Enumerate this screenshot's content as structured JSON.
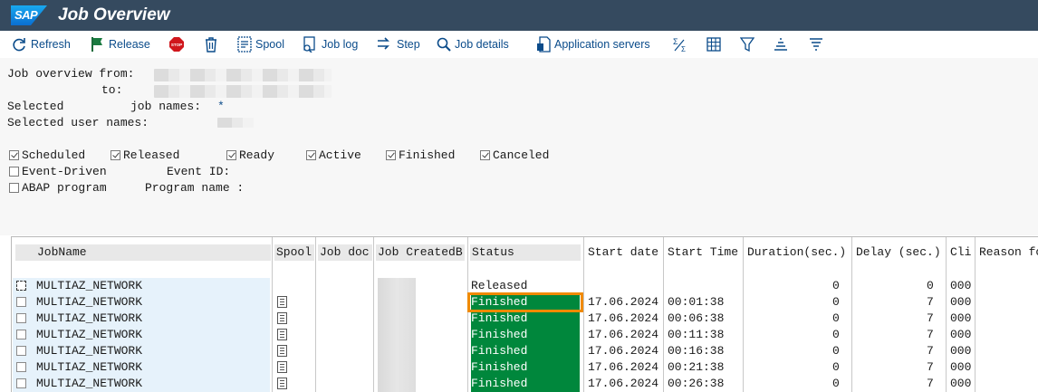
{
  "app": {
    "logo": "SAP",
    "title": "Job Overview"
  },
  "toolbar": {
    "refresh": "Refresh",
    "release": "Release",
    "spool": "Spool",
    "job_log": "Job log",
    "step": "Step",
    "job_details": "Job details",
    "application_servers": "Application servers"
  },
  "criteria": {
    "job_overview_from": "Job overview from:",
    "to": "to:",
    "selected": "Selected",
    "job_names": "job names:",
    "job_names_value": "*",
    "selected_user_names": "Selected user names:",
    "event_id": "Event ID:",
    "program_name": "Program name :"
  },
  "checkboxes": [
    {
      "label": "Scheduled",
      "checked": true
    },
    {
      "label": "Released",
      "checked": true
    },
    {
      "label": "Ready",
      "checked": true
    },
    {
      "label": "Active",
      "checked": true
    },
    {
      "label": "Finished",
      "checked": true
    },
    {
      "label": "Canceled",
      "checked": true
    },
    {
      "label": "Event-Driven",
      "checked": false
    },
    {
      "label": "ABAP program",
      "checked": false
    }
  ],
  "table": {
    "columns": [
      "JobName",
      "Spool",
      "Job doc",
      "Job CreatedB",
      "Status",
      "Start date",
      "Start Time",
      "Duration(sec.)",
      "Delay (sec.)",
      "Cli",
      "Reason fo"
    ],
    "rows": [
      {
        "job": "MULTIAZ_NETWORK",
        "status": "Released",
        "date": "",
        "time": "",
        "duration": "0",
        "delay": "0",
        "client": "000"
      },
      {
        "job": "MULTIAZ_NETWORK",
        "status": "Finished",
        "date": "17.06.2024",
        "time": "00:01:38",
        "duration": "0",
        "delay": "7",
        "client": "000"
      },
      {
        "job": "MULTIAZ_NETWORK",
        "status": "Finished",
        "date": "17.06.2024",
        "time": "00:06:38",
        "duration": "0",
        "delay": "7",
        "client": "000"
      },
      {
        "job": "MULTIAZ_NETWORK",
        "status": "Finished",
        "date": "17.06.2024",
        "time": "00:11:38",
        "duration": "0",
        "delay": "7",
        "client": "000"
      },
      {
        "job": "MULTIAZ_NETWORK",
        "status": "Finished",
        "date": "17.06.2024",
        "time": "00:16:38",
        "duration": "0",
        "delay": "7",
        "client": "000"
      },
      {
        "job": "MULTIAZ_NETWORK",
        "status": "Finished",
        "date": "17.06.2024",
        "time": "00:21:38",
        "duration": "0",
        "delay": "7",
        "client": "000"
      },
      {
        "job": "MULTIAZ_NETWORK",
        "status": "Finished",
        "date": "17.06.2024",
        "time": "00:26:38",
        "duration": "0",
        "delay": "7",
        "client": "000"
      }
    ]
  },
  "colors": {
    "title_bar": "#354a5f",
    "finished_status": "#00873c",
    "highlight_border": "#f08a00",
    "link_blue": "#0a4b8a"
  }
}
